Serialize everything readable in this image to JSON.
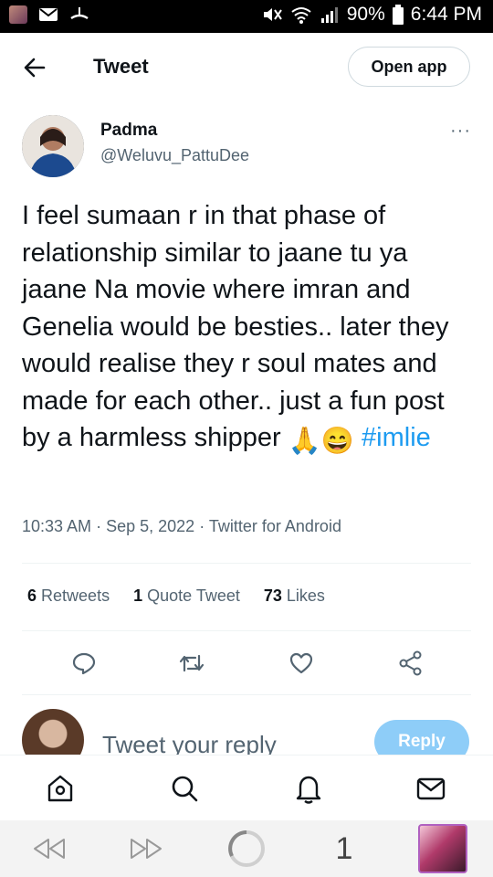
{
  "status_bar": {
    "battery": "90%",
    "time": "6:44 PM"
  },
  "header": {
    "title": "Tweet",
    "open_app": "Open app"
  },
  "tweet": {
    "author_name": "Padma",
    "author_handle": "@Weluvu_PattuDee",
    "more": "···",
    "text": "I feel sumaan r in that phase of relationship similar to jaane tu ya jaane Na movie where imran and Genelia would be besties.. later they would realise they r soul mates and made for each other.. just a fun post by a harmless shipper",
    "emojis": [
      "🙏",
      "😄"
    ],
    "hashtag": "#imlie",
    "time": "10:33 AM",
    "date": "Sep 5, 2022",
    "source": "Twitter for Android",
    "separator": "·"
  },
  "counts": {
    "retweets": "6",
    "retweets_label": "Retweets",
    "quotes": "1",
    "quotes_label": "Quote Tweet",
    "likes": "73",
    "likes_label": "Likes"
  },
  "reply_bar": {
    "placeholder": "Tweet your reply",
    "button": "Reply"
  },
  "browser": {
    "tab_count": "1"
  },
  "colors": {
    "accent": "#1d9bf0",
    "reply_button": "#8ecdf8",
    "muted_text": "#536471"
  }
}
